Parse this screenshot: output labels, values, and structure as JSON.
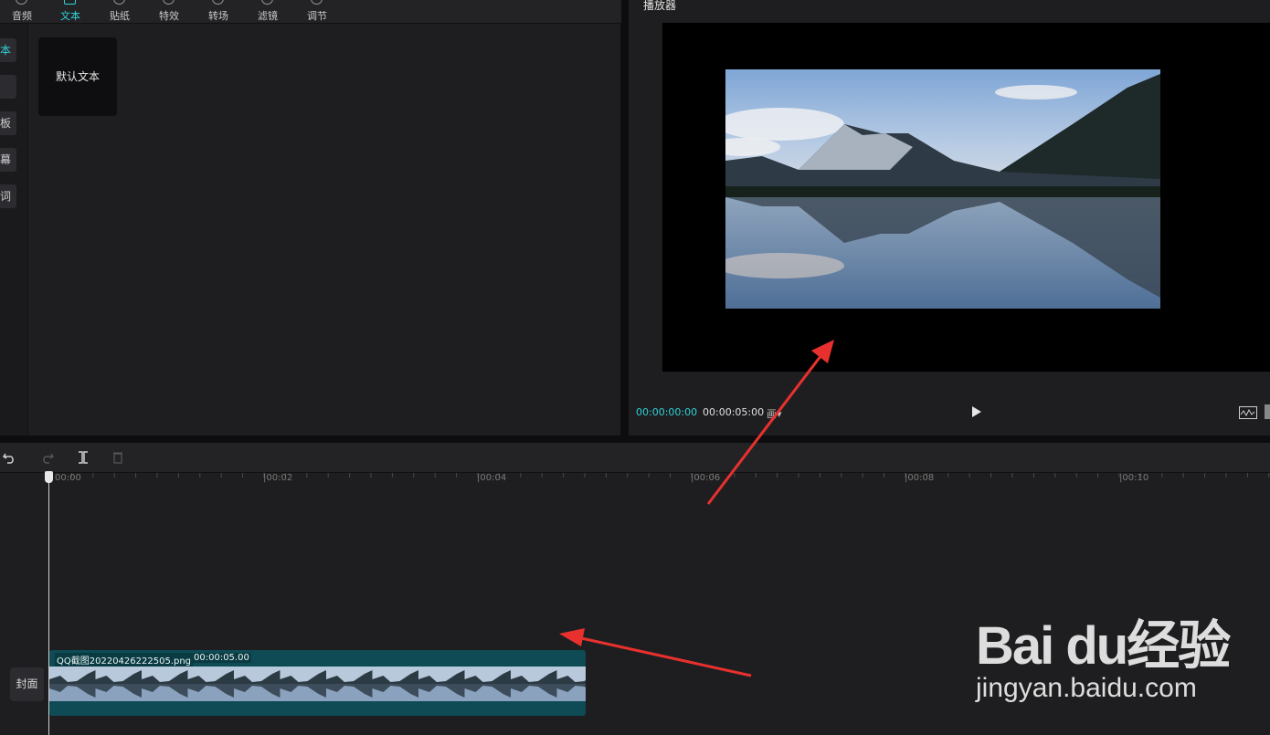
{
  "toolbar": {
    "tabs": [
      {
        "label": "音频",
        "icon": "audio-icon"
      },
      {
        "label": "文本",
        "icon": "text-icon",
        "active": true
      },
      {
        "label": "贴纸",
        "icon": "sticker-icon"
      },
      {
        "label": "特效",
        "icon": "effects-icon"
      },
      {
        "label": "转场",
        "icon": "transition-icon"
      },
      {
        "label": "滤镜",
        "icon": "filter-icon"
      },
      {
        "label": "调节",
        "icon": "adjust-icon"
      }
    ]
  },
  "sidebar": {
    "items": [
      {
        "label": "本",
        "active": true
      },
      {
        "label": ""
      },
      {
        "label": "板"
      },
      {
        "label": "幕"
      },
      {
        "label": "词"
      }
    ]
  },
  "library": {
    "default_text_card": "默认文本"
  },
  "player": {
    "title": "播放器",
    "current_time": "00:00:00:00",
    "total_time": "00:00:05:00",
    "ratio_label": "画▾"
  },
  "timeline": {
    "ruler_labels": [
      "00:00",
      "|00:02",
      "|00:04",
      "|00:06",
      "|00:08",
      "|00:10"
    ],
    "cover_button": "封面",
    "clip": {
      "name": "QQ截图20220426222505.png",
      "duration": "00:00:05.00"
    }
  },
  "watermark": {
    "logo": "Bai du经验",
    "url": "jingyan.baidu.com"
  },
  "colors": {
    "accent": "#2fd3d6",
    "clip_bg": "#0e4b55",
    "arrow": "#e8312e"
  }
}
